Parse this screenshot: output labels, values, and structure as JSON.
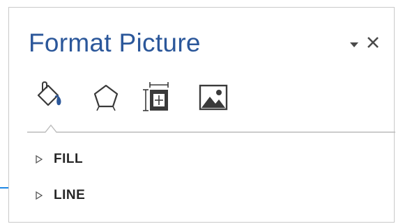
{
  "pane": {
    "title": "Format Picture",
    "menu_icon": "dropdown-triangle-icon",
    "close_icon": "close-icon",
    "close_glyph": "✕"
  },
  "tabs": [
    {
      "name": "fill-and-line",
      "icon": "paint-bucket-icon",
      "selected": true
    },
    {
      "name": "effects",
      "icon": "pentagon-icon",
      "selected": false
    },
    {
      "name": "size-and-properties",
      "icon": "size-properties-icon",
      "selected": false
    },
    {
      "name": "picture",
      "icon": "picture-icon",
      "selected": false
    }
  ],
  "sections": {
    "fill": {
      "label": "FILL",
      "expanded": false
    },
    "line": {
      "label": "LINE",
      "expanded": false
    }
  },
  "colors": {
    "title": "#2b579a",
    "icon": "#3a3a3a",
    "accent_arrow": "#1e88e5",
    "divider": "#bcbcbc"
  }
}
